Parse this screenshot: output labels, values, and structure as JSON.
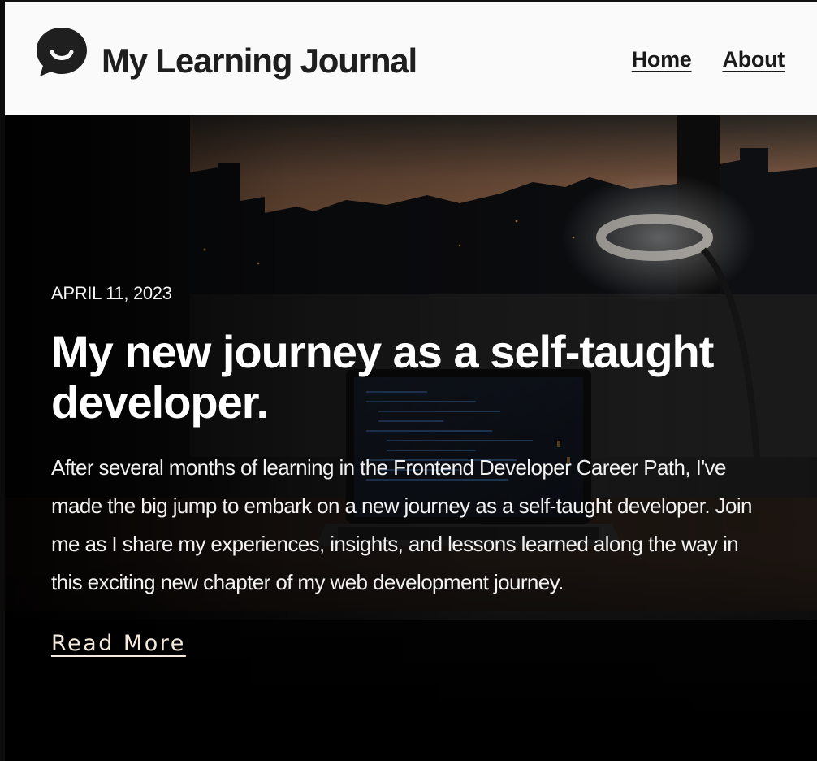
{
  "header": {
    "title": "My Learning Journal",
    "nav": [
      {
        "label": "Home"
      },
      {
        "label": "About"
      }
    ]
  },
  "hero": {
    "date": "APRIL 11, 2023",
    "title": "My new journey as a self-taught developer.",
    "excerpt": "After several months of learning in the Frontend Developer Career Path, I've made the big jump to embark on a new journey as a self-taught developer. Join me as I share my experiences, insights, and lessons learned along the way in this exciting new chapter of my web development journey.",
    "read_more": "Read More",
    "background_description": "desk-with-laptop-and-lamp-at-dusk"
  },
  "icons": {
    "logo": "chat-bubble-smile-icon"
  },
  "colors": {
    "header_bg": "#fafafa",
    "header_text": "#1e1e1e",
    "hero_text": "#ffffff",
    "read_more": "#f4e9dc"
  }
}
